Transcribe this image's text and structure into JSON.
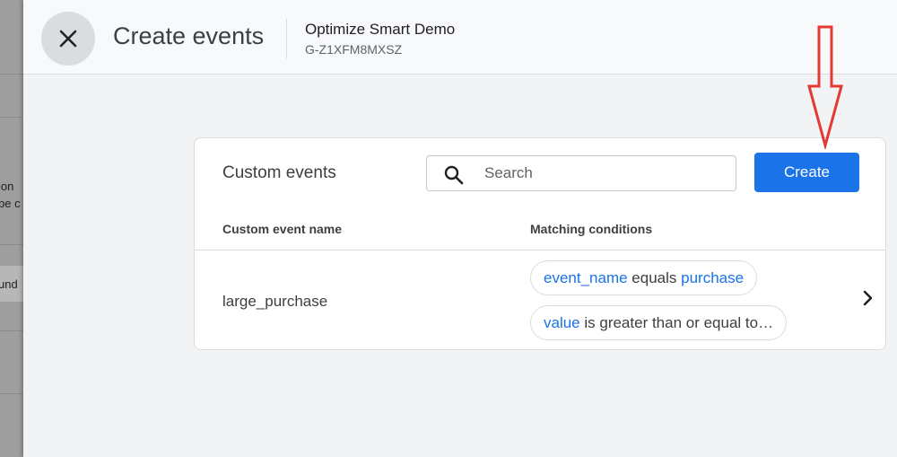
{
  "background_page": {
    "snippet_1": "ion",
    "snippet_2": "be c",
    "snippet_3": "und"
  },
  "header": {
    "close_icon": "close-icon",
    "title": "Create events",
    "property_name": "Optimize Smart Demo",
    "property_id": "G-Z1XFM8MXSZ"
  },
  "card": {
    "title": "Custom events",
    "search": {
      "placeholder": "Search",
      "value": "",
      "icon": "search-icon"
    },
    "create_label": "Create",
    "columns": [
      "Custom event name",
      "Matching conditions"
    ],
    "rows": [
      {
        "name": "large_purchase",
        "conditions": [
          {
            "param": "event_name",
            "operator": " equals ",
            "value": "purchase"
          },
          {
            "param": "value",
            "operator": " is greater than or equal to…",
            "value": ""
          }
        ]
      }
    ]
  },
  "colors": {
    "accent": "#1a73e8",
    "annotation_arrow": "#e53935"
  }
}
